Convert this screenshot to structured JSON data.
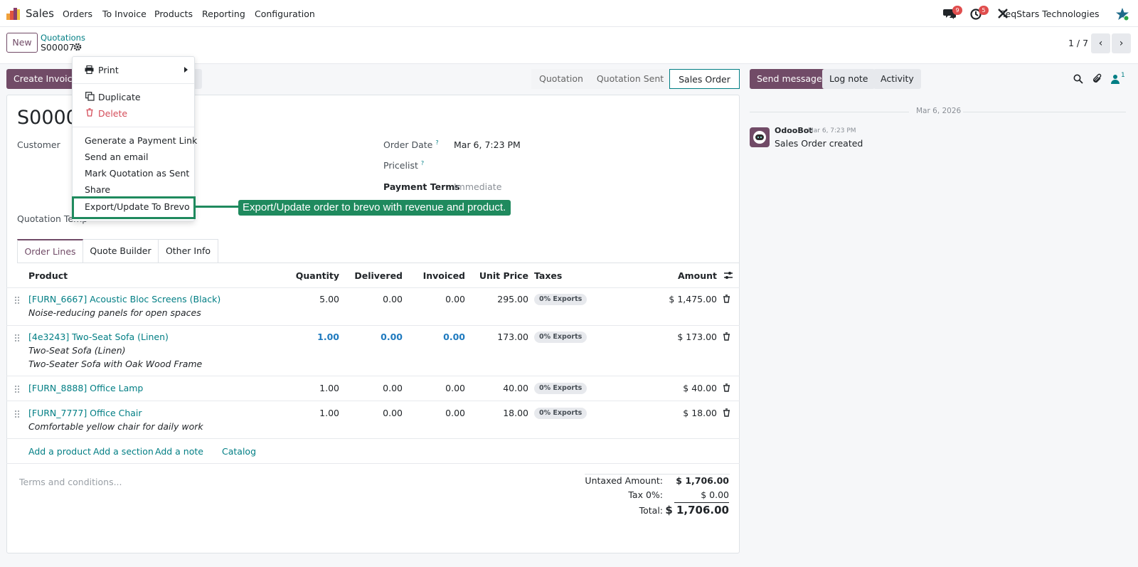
{
  "topnav": {
    "app": "Sales",
    "menu": [
      "Orders",
      "To Invoice",
      "Products",
      "Reporting",
      "Configuration"
    ],
    "chat_badge": "9",
    "activity_badge": "5",
    "company": "TeqStars Technologies"
  },
  "control": {
    "new_label": "New",
    "breadcrumb_parent": "Quotations",
    "breadcrumb_current": "S00007",
    "pager": "1 / 7"
  },
  "actions": {
    "create_invoice": "Create Invoice"
  },
  "statusbar": [
    "Quotation",
    "Quotation Sent",
    "Sales Order"
  ],
  "form": {
    "title": "S0000",
    "customer_label": "Customer",
    "quotation_template_label": "Quotation Temp",
    "order_date_label": "Order Date",
    "order_date_help": "?",
    "order_date_value": "Mar 6, 7:23 PM",
    "pricelist_label": "Pricelist",
    "pricelist_help": "?",
    "payment_terms_label": "Payment Terms",
    "payment_terms_value": "Immediate"
  },
  "tabs": [
    "Order Lines",
    "Quote Builder",
    "Other Info"
  ],
  "table": {
    "headers": [
      "Product",
      "Quantity",
      "Delivered",
      "Invoiced",
      "Unit Price",
      "Taxes",
      "Amount"
    ],
    "rows": [
      {
        "product": "[FURN_6667] Acoustic Bloc Screens (Black)",
        "desc": [
          "Noise-reducing panels for open spaces"
        ],
        "qty": "5.00",
        "delivered": "0.00",
        "invoiced": "0.00",
        "price": "295.00",
        "tax": "0% Exports",
        "amount": "$ 1,475.00"
      },
      {
        "product": "[4e3243] Two-Seat Sofa (Linen)",
        "desc": [
          "Two-Seat Sofa (Linen)",
          "Two-Seater Sofa with Oak Wood Frame"
        ],
        "qty": "1.00",
        "delivered": "0.00",
        "invoiced": "0.00",
        "price": "173.00",
        "tax": "0% Exports",
        "amount": "$ 173.00"
      },
      {
        "product": "[FURN_8888] Office Lamp",
        "desc": [],
        "qty": "1.00",
        "delivered": "0.00",
        "invoiced": "0.00",
        "price": "40.00",
        "tax": "0% Exports",
        "amount": "$ 40.00"
      },
      {
        "product": "[FURN_7777] Office Chair",
        "desc": [
          "Comfortable yellow chair for daily work"
        ],
        "qty": "1.00",
        "delivered": "0.00",
        "invoiced": "0.00",
        "price": "18.00",
        "tax": "0% Exports",
        "amount": "$ 18.00"
      }
    ],
    "add_links": [
      "Add a product",
      "Add a section",
      "Add a note",
      "Catalog"
    ]
  },
  "terms_placeholder": "Terms and conditions...",
  "totals": {
    "untaxed_label": "Untaxed Amount:",
    "untaxed_value": "$ 1,706.00",
    "tax_label": "Tax 0%:",
    "tax_value": "$ 0.00",
    "total_label": "Total:",
    "total_value": "$ 1,706.00"
  },
  "chatter": {
    "send_message": "Send message",
    "log_note": "Log note",
    "activity": "Activity",
    "followers": "1",
    "date": "Mar 6, 2026",
    "author": "OdooBot",
    "time": "Mar 6, 7:23 PM",
    "message": "Sales Order created"
  },
  "dropdown": {
    "print": "Print",
    "duplicate": "Duplicate",
    "delete": "Delete",
    "items": [
      "Generate a Payment Link",
      "Send an email",
      "Mark Quotation as Sent",
      "Share"
    ],
    "brevo": "Export/Update To Brevo"
  },
  "callout": "Export/Update order to brevo with revenue and product.",
  "colors": {
    "brand": "#714b67",
    "link": "#017e84",
    "highlight": "#1f8a5e"
  },
  "icons": [
    "chat-icon",
    "clock-icon",
    "tools-icon",
    "star-avatar-icon",
    "gear-icon",
    "printer-icon",
    "copy-icon",
    "trash-icon",
    "search-icon",
    "paperclip-icon",
    "user-icon",
    "settings-sliders-icon",
    "drag-handle-icon"
  ]
}
